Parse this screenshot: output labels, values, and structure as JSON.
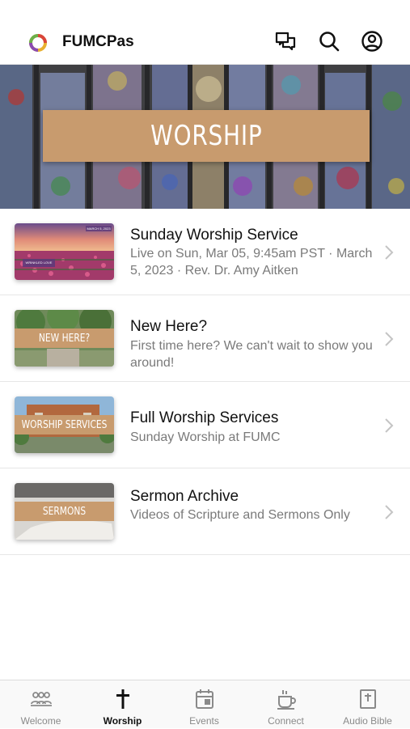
{
  "header": {
    "app_title": "FUMCPas",
    "icons": [
      "chat-icon",
      "search-icon",
      "profile-icon"
    ]
  },
  "hero": {
    "banner_text": "WORSHIP"
  },
  "list": [
    {
      "title": "Sunday Worship Service",
      "subtitle": "Live on Sun, Mar 05, 9:45am PST · March 5, 2023 · Rev. Dr. Amy Aitken",
      "thumb_date": "MARCH 5, 2023",
      "thumb_caption": "WRINKLED LOVE"
    },
    {
      "title": "New Here?",
      "subtitle": "First time here? We can't wait to show you around!",
      "thumb_text": "NEW HERE?"
    },
    {
      "title": "Full Worship Services",
      "subtitle": "Sunday Worship at FUMC",
      "thumb_text": "WORSHIP SERVICES"
    },
    {
      "title": "Sermon Archive",
      "subtitle": "Videos of Scripture and Sermons Only",
      "thumb_text": "SERMONS"
    }
  ],
  "tabs": [
    {
      "label": "Welcome",
      "icon": "people-icon",
      "active": false
    },
    {
      "label": "Worship",
      "icon": "cross-icon",
      "active": true
    },
    {
      "label": "Events",
      "icon": "calendar-icon",
      "active": false
    },
    {
      "label": "Connect",
      "icon": "coffee-cup-icon",
      "active": false
    },
    {
      "label": "Audio Bible",
      "icon": "bible-icon",
      "active": false
    }
  ],
  "colors": {
    "accent_tan": "#c89b6e",
    "text_primary": "#111111",
    "text_secondary": "#7a7a7a",
    "tab_inactive": "#8a8a8a"
  }
}
